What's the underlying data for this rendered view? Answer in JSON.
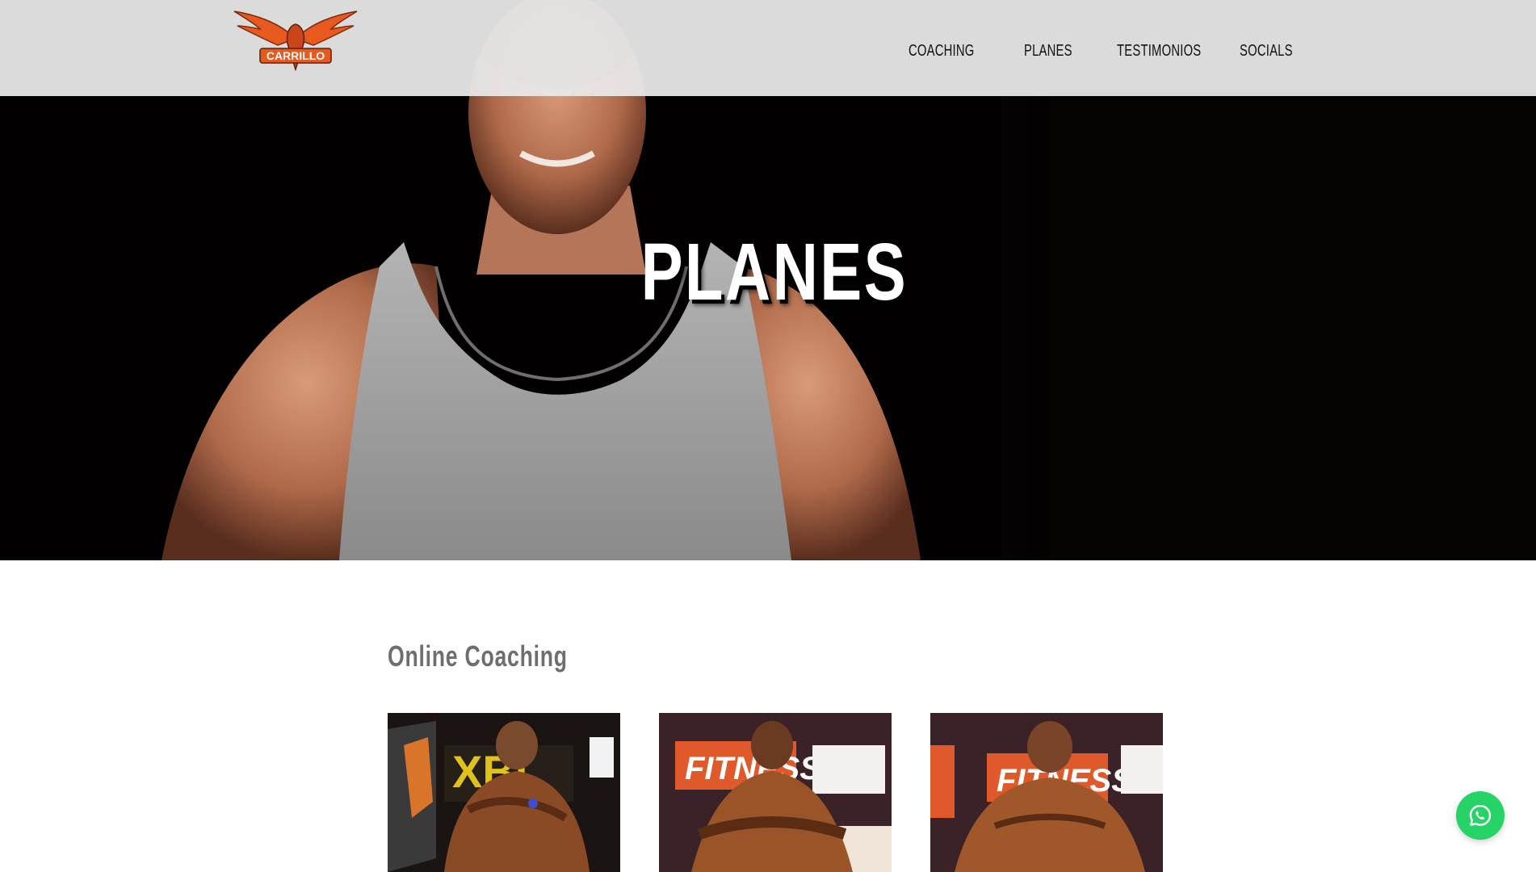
{
  "brand": {
    "logo_text": "CARRILLO",
    "logo_icon": "eagle-logo",
    "colors": {
      "accent": "#e8591e",
      "header_bg": "#e9e9e9",
      "hero_bg": "#030002",
      "whatsapp": "#25d366"
    }
  },
  "nav": {
    "items": [
      {
        "label": "COACHING"
      },
      {
        "label": "PLANES"
      },
      {
        "label": "TESTIMONIOS"
      },
      {
        "label": "SOCIALS"
      }
    ]
  },
  "hero": {
    "title": "PLANES"
  },
  "section": {
    "title": "Online Coaching",
    "cards": [
      {
        "banner_text": "XBL",
        "icon": "competition-photo"
      },
      {
        "banner_text": "FITNESS",
        "icon": "competition-photo"
      },
      {
        "banner_text": "FITNESS",
        "icon": "competition-photo"
      }
    ]
  },
  "whatsapp": {
    "icon": "whatsapp-icon"
  }
}
